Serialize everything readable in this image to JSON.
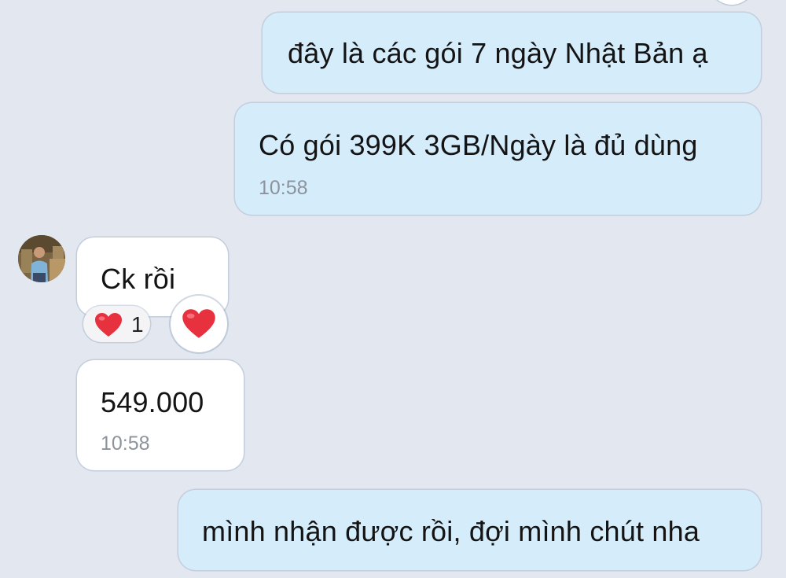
{
  "colors": {
    "background": "#e2e7f0",
    "outgoing_bubble": "#d5ecfb",
    "incoming_bubble": "#ffffff",
    "timestamp": "#8c939c",
    "heart": "#e8313f"
  },
  "messages": [
    {
      "direction": "outgoing",
      "text": "đây là các gói 7 ngày Nhật Bản ạ"
    },
    {
      "direction": "outgoing",
      "text": "Có gói 399K 3GB/Ngày là đủ dùng",
      "time": "10:58"
    },
    {
      "direction": "incoming",
      "text": "Ck rồi",
      "reactions": {
        "icon": "heart-icon",
        "count": "1"
      }
    },
    {
      "direction": "incoming",
      "text": "549.000",
      "time": "10:58"
    },
    {
      "direction": "outgoing",
      "text": "mình nhận được rồi, đợi mình chút nha"
    }
  ]
}
